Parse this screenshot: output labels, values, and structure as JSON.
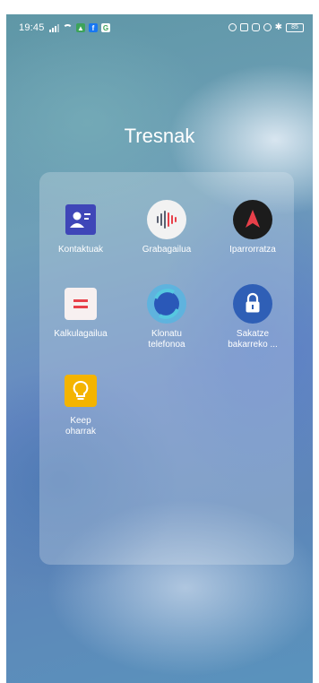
{
  "status_bar": {
    "time": "19:45",
    "battery": "85"
  },
  "folder": {
    "title": "Tresnak",
    "apps": [
      {
        "label": "Kontaktuak",
        "icon": "contacts-icon"
      },
      {
        "label": "Grabagailua",
        "icon": "recorder-icon"
      },
      {
        "label": "Iparrorratza",
        "icon": "compass-icon"
      },
      {
        "label": "Kalkulagailua",
        "icon": "calculator-icon"
      },
      {
        "label": "Klonatu telefonoa",
        "icon": "clone-phone-icon"
      },
      {
        "label": "Sakatze bakarreko ...",
        "icon": "lock-icon"
      },
      {
        "label": "Keep oharrak",
        "icon": "lightbulb-icon"
      }
    ]
  },
  "colors": {
    "contacts": "#3f46b8",
    "compass_bg": "#1c1c1c",
    "compass_needle": "#e8404a",
    "calculator_bar": "#e8404a",
    "lock_bg": "#2f5fb6",
    "keep": "#f4b400"
  }
}
